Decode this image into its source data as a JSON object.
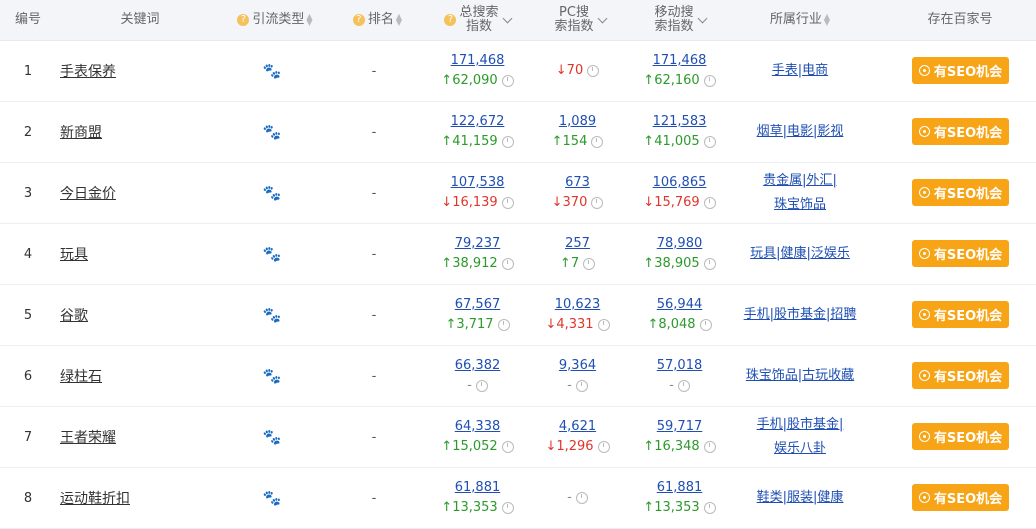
{
  "headers": {
    "id": "编号",
    "keyword": "关键词",
    "flow_type": "引流类型",
    "rank": "排名",
    "total_1": "总搜索",
    "total_2": "指数",
    "pc_1": "PC搜",
    "pc_2": "索指数",
    "mobile_1": "移动搜",
    "mobile_2": "索指数",
    "industry": "所属行业",
    "baijia": "存在百家号"
  },
  "seo_label": "有SEO机会",
  "colors": {
    "up": "#2b9a2b",
    "down": "#e0352b",
    "button": "#f7a417",
    "link": "#1f4fb3"
  },
  "rows": [
    {
      "id": "1",
      "keyword": "手表保养",
      "rank": "-",
      "total": "171,468",
      "total_chg": "62,090",
      "total_dir": "up",
      "pc": "",
      "pc_chg": "70",
      "pc_dir": "down",
      "mobile": "171,468",
      "mobile_chg": "62,160",
      "mobile_dir": "up",
      "industry": [
        "手表|电商"
      ]
    },
    {
      "id": "2",
      "keyword": "新商盟",
      "rank": "-",
      "total": "122,672",
      "total_chg": "41,159",
      "total_dir": "up",
      "pc": "1,089",
      "pc_chg": "154",
      "pc_dir": "up",
      "mobile": "121,583",
      "mobile_chg": "41,005",
      "mobile_dir": "up",
      "industry": [
        "烟草|电影|影视"
      ]
    },
    {
      "id": "3",
      "keyword": "今日金价",
      "rank": "-",
      "total": "107,538",
      "total_chg": "16,139",
      "total_dir": "down",
      "pc": "673",
      "pc_chg": "370",
      "pc_dir": "down",
      "mobile": "106,865",
      "mobile_chg": "15,769",
      "mobile_dir": "down",
      "industry": [
        "贵金属|外汇|",
        "珠宝饰品"
      ]
    },
    {
      "id": "4",
      "keyword": "玩具",
      "rank": "-",
      "total": "79,237",
      "total_chg": "38,912",
      "total_dir": "up",
      "pc": "257",
      "pc_chg": "7",
      "pc_dir": "up",
      "mobile": "78,980",
      "mobile_chg": "38,905",
      "mobile_dir": "up",
      "industry": [
        "玩具|健康|泛娱乐"
      ]
    },
    {
      "id": "5",
      "keyword": "谷歌",
      "rank": "-",
      "total": "67,567",
      "total_chg": "3,717",
      "total_dir": "up",
      "pc": "10,623",
      "pc_chg": "4,331",
      "pc_dir": "down",
      "mobile": "56,944",
      "mobile_chg": "8,048",
      "mobile_dir": "up",
      "industry": [
        "手机|股市基金|招聘"
      ]
    },
    {
      "id": "6",
      "keyword": "绿柱石",
      "rank": "-",
      "total": "66,382",
      "total_chg": "-",
      "total_dir": "flat",
      "pc": "9,364",
      "pc_chg": "-",
      "pc_dir": "flat",
      "mobile": "57,018",
      "mobile_chg": "-",
      "mobile_dir": "flat",
      "industry": [
        "珠宝饰品|古玩收藏"
      ]
    },
    {
      "id": "7",
      "keyword": "王者荣耀",
      "rank": "-",
      "total": "64,338",
      "total_chg": "15,052",
      "total_dir": "up",
      "pc": "4,621",
      "pc_chg": "1,296",
      "pc_dir": "down",
      "mobile": "59,717",
      "mobile_chg": "16,348",
      "mobile_dir": "up",
      "industry": [
        "手机|股市基金|",
        "娱乐八卦"
      ]
    },
    {
      "id": "8",
      "keyword": "运动鞋折扣",
      "rank": "-",
      "total": "61,881",
      "total_chg": "13,353",
      "total_dir": "up",
      "pc": "",
      "pc_chg": "-",
      "pc_dir": "flat",
      "mobile": "61,881",
      "mobile_chg": "13,353",
      "mobile_dir": "up",
      "industry": [
        "鞋类|服装|健康"
      ]
    }
  ]
}
